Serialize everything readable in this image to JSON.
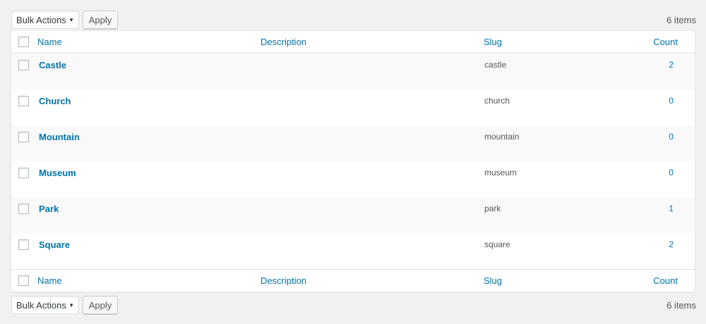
{
  "toolbar": {
    "bulk_actions": "Bulk Actions",
    "apply": "Apply",
    "items_count": "6 items"
  },
  "columns": {
    "name": "Name",
    "description": "Description",
    "slug": "Slug",
    "count": "Count"
  },
  "rows": [
    {
      "name": "Castle",
      "description": "",
      "slug": "castle",
      "count": "2"
    },
    {
      "name": "Church",
      "description": "",
      "slug": "church",
      "count": "0"
    },
    {
      "name": "Mountain",
      "description": "",
      "slug": "mountain",
      "count": "0"
    },
    {
      "name": "Museum",
      "description": "",
      "slug": "museum",
      "count": "0"
    },
    {
      "name": "Park",
      "description": "",
      "slug": "park",
      "count": "1"
    },
    {
      "name": "Square",
      "description": "",
      "slug": "square",
      "count": "2"
    }
  ],
  "colors": {
    "link": "#0073aa",
    "background": "#f1f1f1",
    "row_alt": "#f9f9f9"
  }
}
